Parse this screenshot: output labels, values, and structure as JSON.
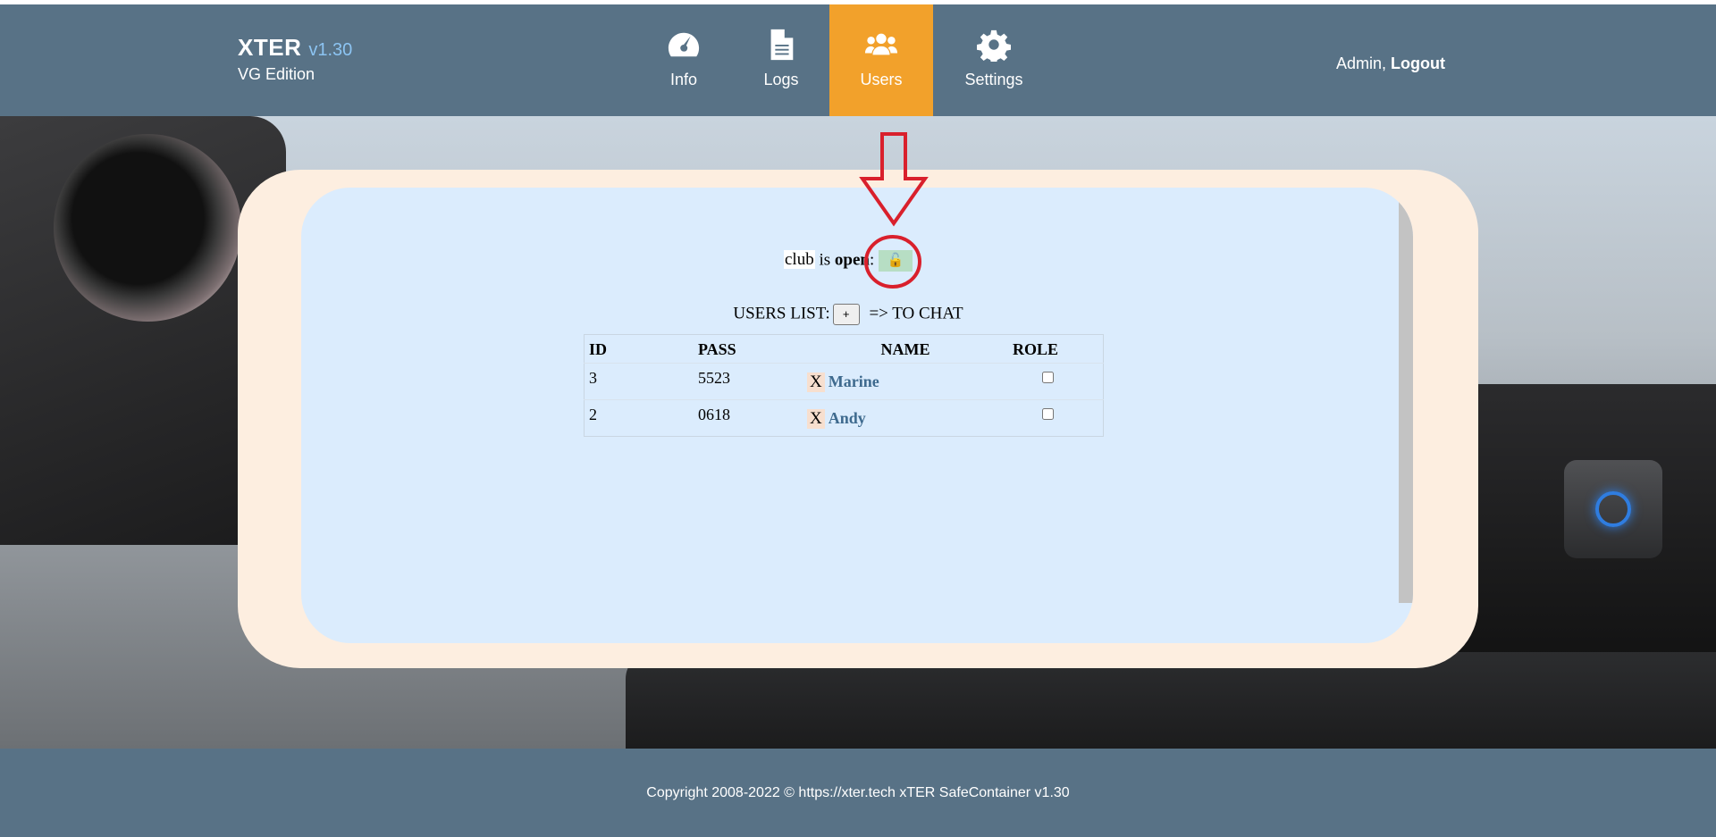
{
  "brand": {
    "title": "XTER",
    "version": "v1.30",
    "edition": "VG Edition"
  },
  "nav": [
    {
      "label": "Info",
      "icon": "dashboard-icon",
      "active": false
    },
    {
      "label": "Logs",
      "icon": "document-icon",
      "active": false
    },
    {
      "label": "Users",
      "icon": "users-icon",
      "active": true
    },
    {
      "label": "Settings",
      "icon": "gear-icon",
      "active": false
    }
  ],
  "user": {
    "name": "Admin,",
    "logout_label": "Logout"
  },
  "status": {
    "subject": "club",
    "verb": "is",
    "state": "open",
    "separator": ":",
    "lock_icon": "open-lock-icon"
  },
  "users_list": {
    "label": "USERS LIST:",
    "add_label": "+",
    "chat_label": "=> TO CHAT",
    "columns": [
      "ID",
      "PASS",
      "NAME",
      "ROLE"
    ],
    "rows": [
      {
        "id": "3",
        "pass": "5523",
        "delete_label": "X",
        "name": "Marine",
        "role_checked": false
      },
      {
        "id": "2",
        "pass": "0618",
        "delete_label": "X",
        "name": "Andy",
        "role_checked": false
      }
    ]
  },
  "footer": {
    "text": "Copyright 2008-2022 © https://xter.tech xTER SafeContainer v1.30"
  },
  "colors": {
    "header": "#587286",
    "active_tab": "#f2a12b",
    "card_outer": "#fdeee0",
    "card_inner": "#dbecfd",
    "annotation": "#d9202c"
  }
}
